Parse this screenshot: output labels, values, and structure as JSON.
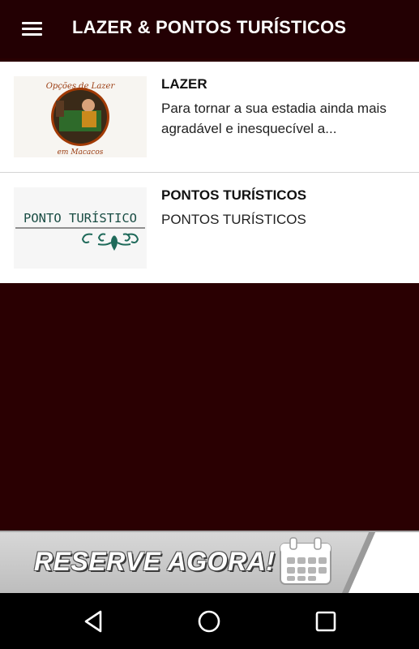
{
  "appbar": {
    "title": "LAZER & PONTOS TURÍSTICOS",
    "menu_icon": "hamburger-menu-icon"
  },
  "items": [
    {
      "title": "LAZER",
      "description": "Para tornar a sua estadia ainda mais agradável e inesquecível a...",
      "thumbnail_text_top": "Opções de Lazer",
      "thumbnail_text_bottom": "em Macacos"
    },
    {
      "title": "PONTOS TURÍSTICOS",
      "description": "PONTOS TURÍSTICOS",
      "thumbnail_text": "PONTO TURÍSTICO"
    }
  ],
  "banner": {
    "label": "RESERVE AGORA!",
    "icon": "calendar-icon"
  },
  "navbar": {
    "back_icon": "back-triangle-icon",
    "home_icon": "home-circle-icon",
    "recents_icon": "recents-square-icon"
  },
  "colors": {
    "appbar": "#230003",
    "background": "#2a0002",
    "banner_gray": "#c9c9c9"
  }
}
